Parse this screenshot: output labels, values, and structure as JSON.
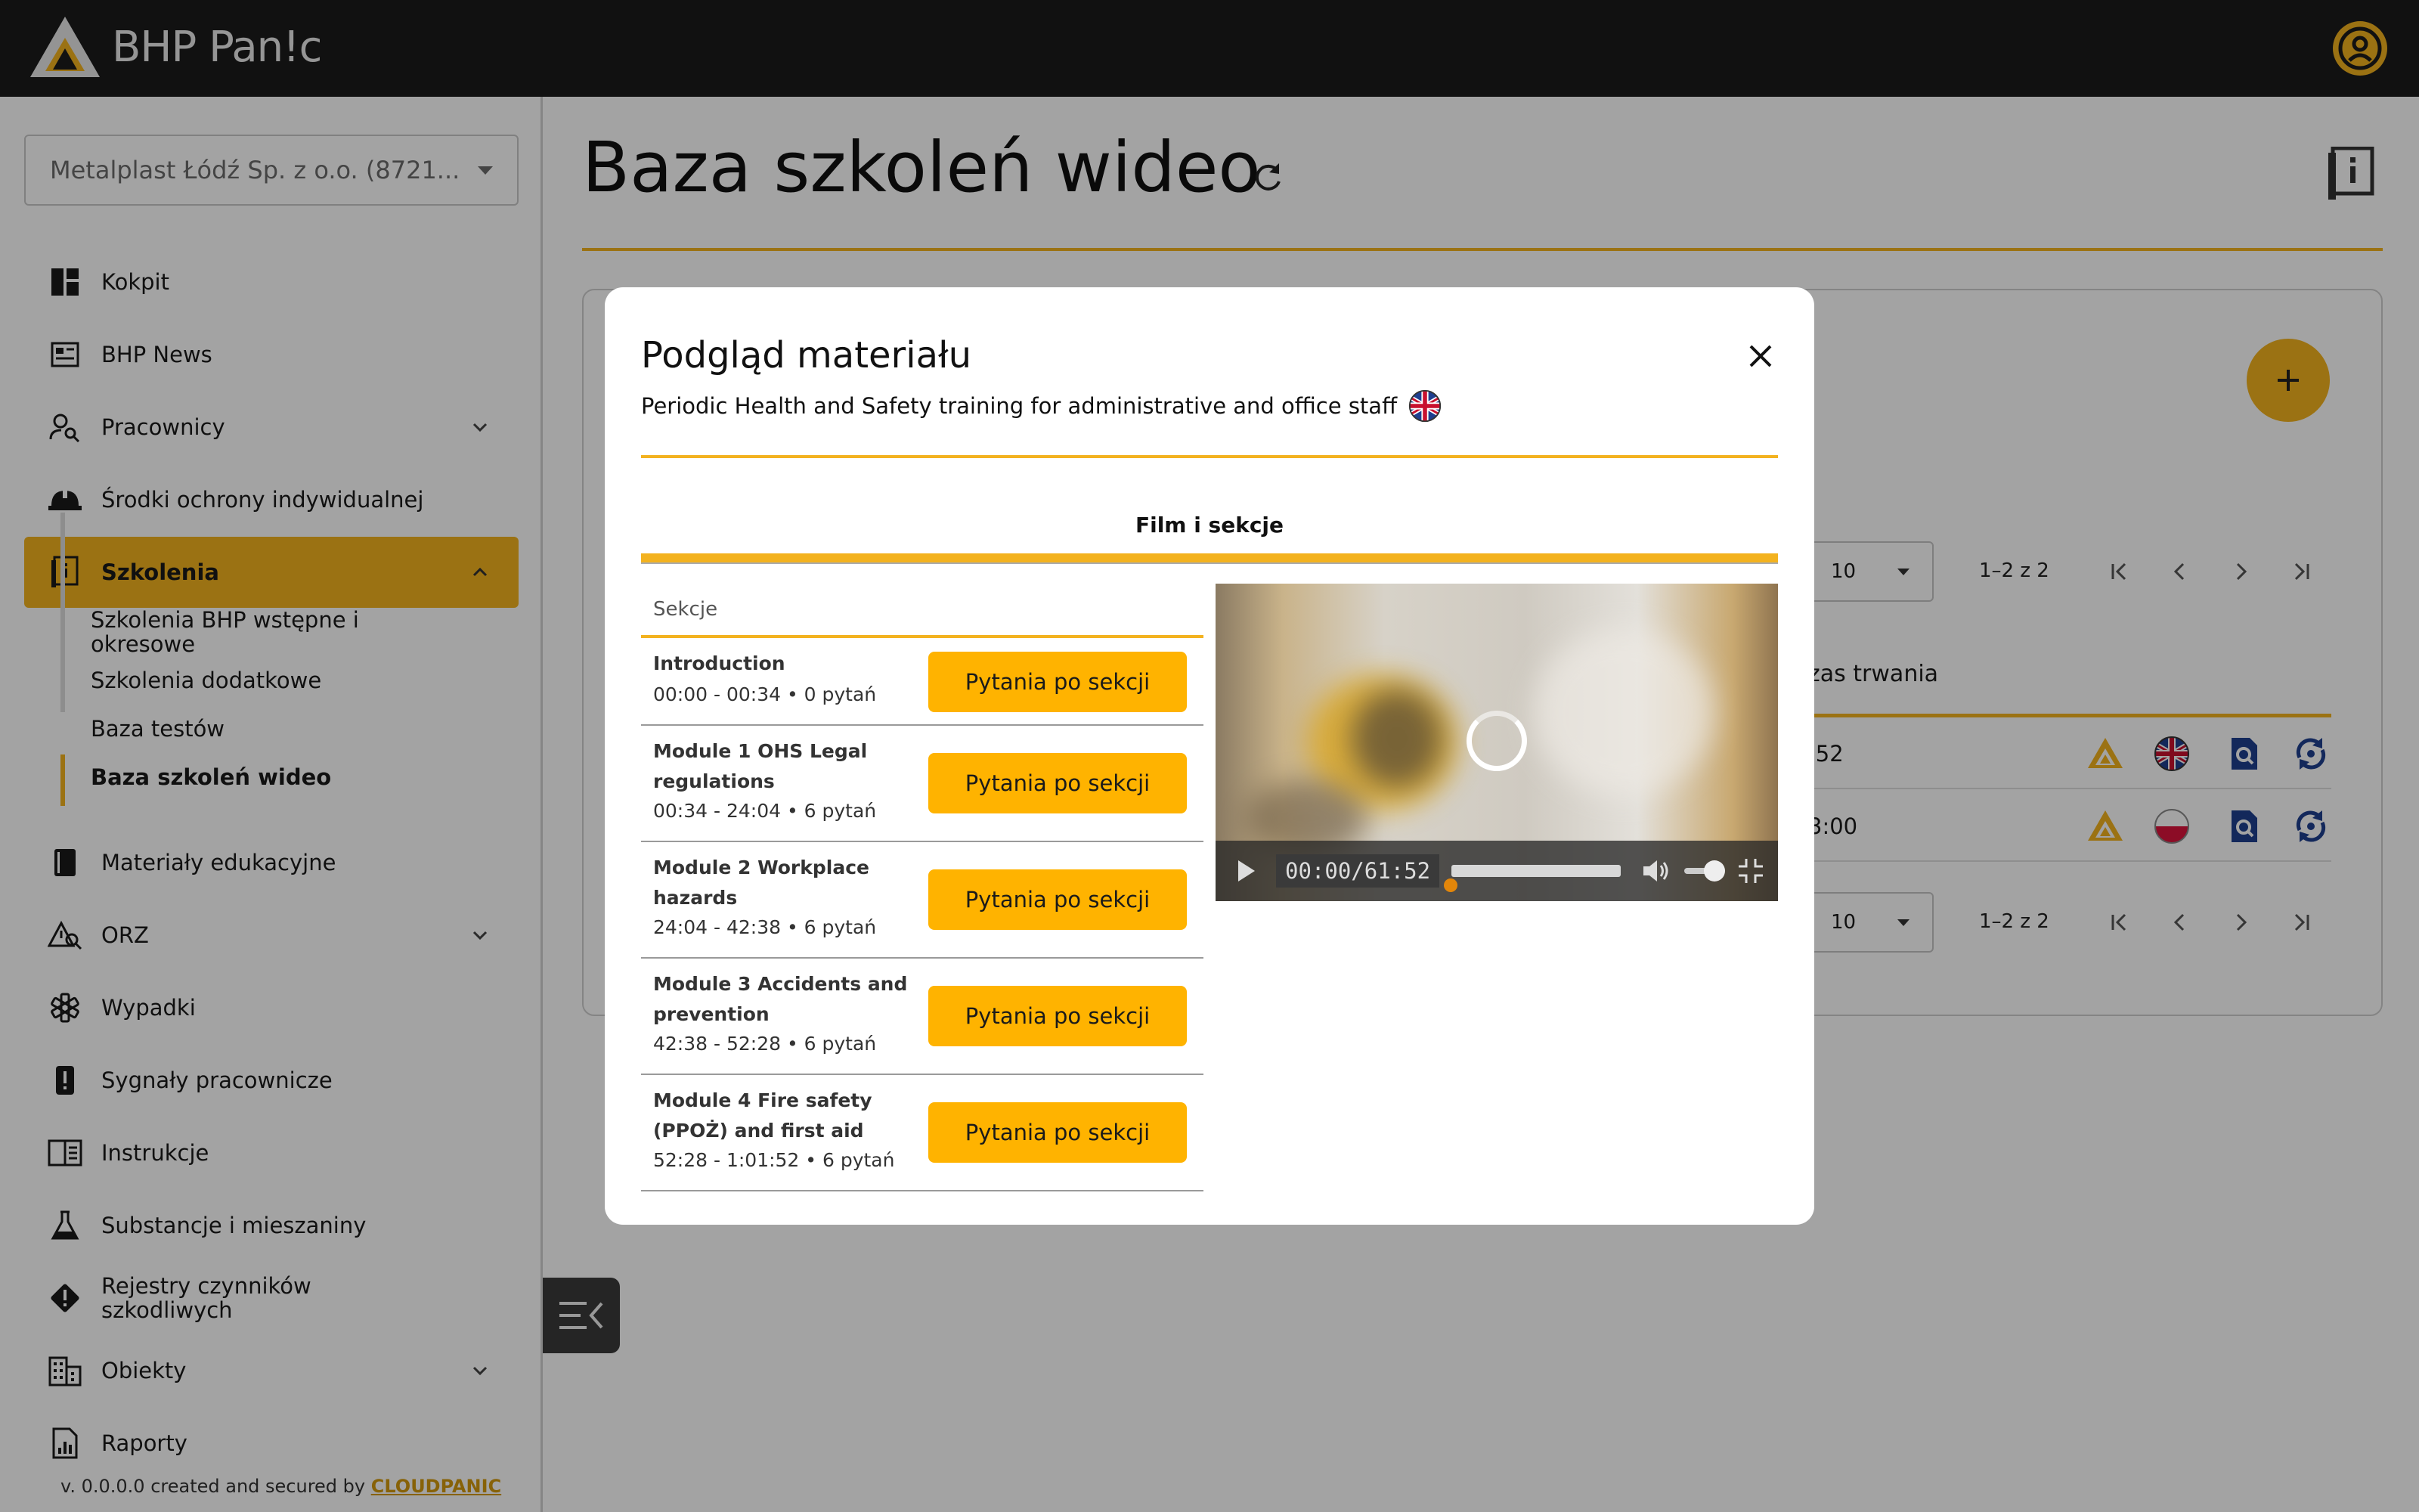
{
  "app": {
    "brand": "BHP Pan!c"
  },
  "sidebar": {
    "company": "Metalplast Łódź Sp. z o.o. (8721...",
    "items": [
      {
        "label": "Kokpit"
      },
      {
        "label": "BHP News"
      },
      {
        "label": "Pracownicy"
      },
      {
        "label": "Środki ochrony indywidualnej"
      },
      {
        "label": "Szkolenia"
      },
      {
        "label": "Materiały edukacyjne"
      },
      {
        "label": "ORZ"
      },
      {
        "label": "Wypadki"
      },
      {
        "label": "Sygnały pracownicze"
      },
      {
        "label": "Instrukcje"
      },
      {
        "label": "Substancje i mieszaniny"
      },
      {
        "label": "Rejestry czynników szkodliwych"
      },
      {
        "label": "Obiekty"
      },
      {
        "label": "Raporty"
      }
    ],
    "sub_items": [
      {
        "label": "Szkolenia BHP wstępne i okresowe"
      },
      {
        "label": "Szkolenia dodatkowe"
      },
      {
        "label": "Baza testów"
      },
      {
        "label": "Baza szkoleń wideo"
      }
    ],
    "footer": {
      "prefix": "v. 0.0.0.0 created and secured by ",
      "brand": "CLOUDPANIC"
    }
  },
  "main": {
    "title": "Baza szkoleń wideo",
    "table": {
      "page_size": "10",
      "page_range": "1–2 z 2",
      "column_duration": "zas trwania",
      "rows": [
        {
          "duration": ":52",
          "flag": "uk-flag-icon"
        },
        {
          "duration": "3:00",
          "flag": "pl-flag-icon"
        }
      ]
    }
  },
  "modal": {
    "title": "Podgląd materiału",
    "subtitle": "Periodic Health and Safety training for administrative and office staff",
    "tab": "Film i sekcje",
    "sections_header": "Sekcje",
    "question_button": "Pytania po sekcji",
    "sections": [
      {
        "name": "Introduction",
        "meta": "00:00 - 00:34 • 0 pytań"
      },
      {
        "name": "Module 1 OHS Legal regulations",
        "meta": "00:34 - 24:04 • 6 pytań"
      },
      {
        "name": "Module 2 Workplace hazards",
        "meta": "24:04 - 42:38 • 6 pytań"
      },
      {
        "name": "Module 3 Accidents and prevention",
        "meta": "42:38 - 52:28 • 6 pytań"
      },
      {
        "name": "Module 4 Fire safety (PPOŻ) and first aid",
        "meta": "52:28 - 1:01:52 • 6 pytań"
      }
    ],
    "video": {
      "time": "00:00/61:52"
    }
  },
  "colors": {
    "accent": "#f3b21f",
    "button": "#ffb300",
    "topbar": "#1b1b1b",
    "icon_blue": "#1f3f8f"
  }
}
